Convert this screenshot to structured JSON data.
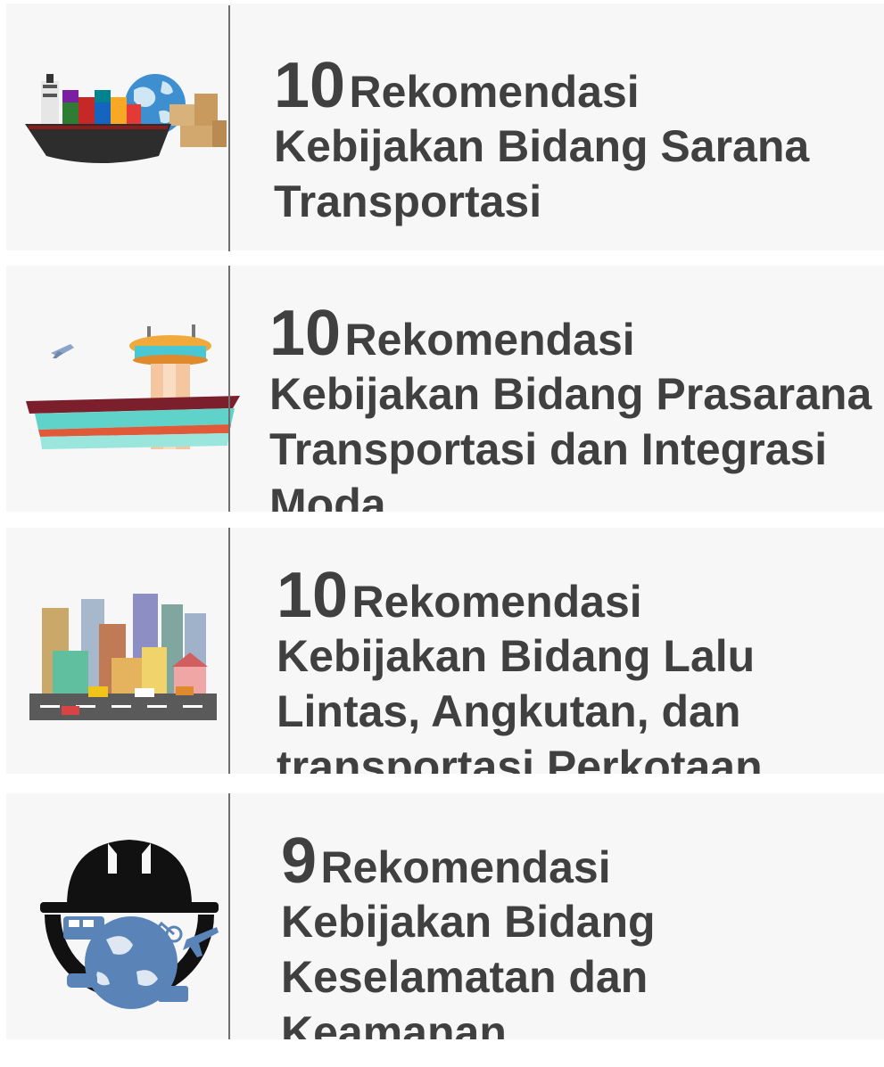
{
  "cards": [
    {
      "number": "10",
      "lead": "Rekomendasi",
      "rest": "Kebijakan Bidang Sarana Transportasi",
      "icon": "cargo-ship-globe-icon"
    },
    {
      "number": "10",
      "lead": "Rekomendasi",
      "rest": "Kebijakan Bidang Prasarana Transportasi dan Integrasi Moda",
      "icon": "airport-terminal-icon"
    },
    {
      "number": "10",
      "lead": "Rekomendasi",
      "rest": "Kebijakan Bidang Lalu Lintas, Angkutan, dan transportasi Perkotaan",
      "icon": "city-traffic-icon"
    },
    {
      "number": "9",
      "lead": "Rekomendasi",
      "rest": "Kebijakan Bidang Keselamatan dan Keamanan",
      "icon": "safety-helmet-globe-icon"
    }
  ],
  "colors": {
    "card_background": "#f7f7f7",
    "text": "#404040",
    "divider": "#6e6e6e"
  }
}
